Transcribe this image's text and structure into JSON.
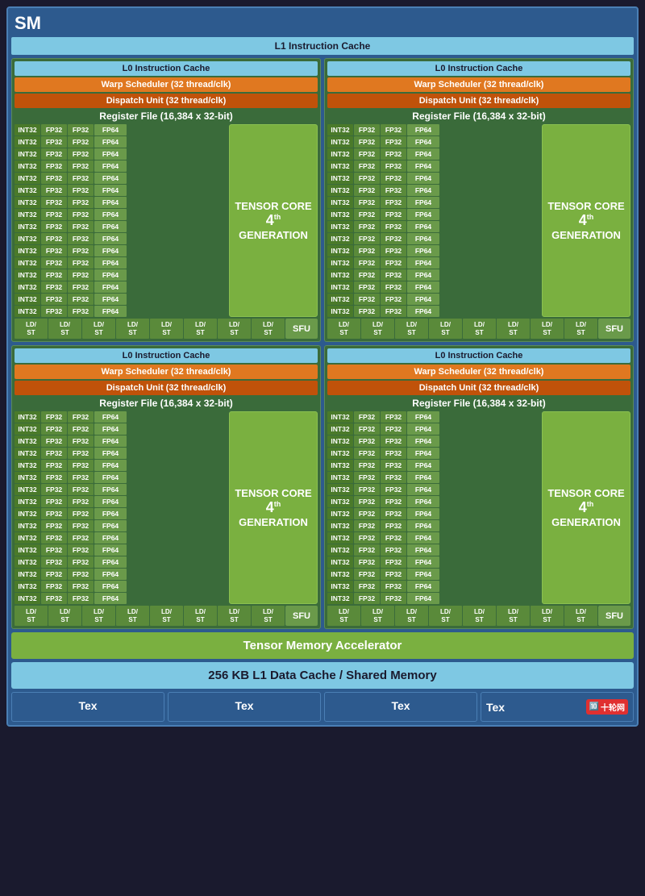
{
  "sm": {
    "title": "SM",
    "l1_instruction_cache": "L1 Instruction Cache",
    "tensor_memory_accelerator": "Tensor Memory Accelerator",
    "l1_data_cache": "256 KB L1 Data Cache / Shared Memory",
    "tex_units": [
      "Tex",
      "Tex",
      "Tex",
      "Tex"
    ],
    "logo": "十轮网"
  },
  "sub_partition": {
    "l0_cache": "L0 Instruction Cache",
    "warp_scheduler": "Warp Scheduler (32 thread/clk)",
    "dispatch_unit": "Dispatch Unit (32 thread/clk)",
    "register_file": "Register File (16,384 x 32-bit)",
    "tensor_core_line1": "TENSOR CORE",
    "tensor_core_line2": "4",
    "tensor_core_line3": "GENERATION",
    "sfu": "SFU",
    "cu_rows": [
      [
        "INT32",
        "FP32",
        "FP32",
        "FP64"
      ],
      [
        "INT32",
        "FP32",
        "FP32",
        "FP64"
      ],
      [
        "INT32",
        "FP32",
        "FP32",
        "FP64"
      ],
      [
        "INT32",
        "FP32",
        "FP32",
        "FP64"
      ],
      [
        "INT32",
        "FP32",
        "FP32",
        "FP64"
      ],
      [
        "INT32",
        "FP32",
        "FP32",
        "FP64"
      ],
      [
        "INT32",
        "FP32",
        "FP32",
        "FP64"
      ],
      [
        "INT32",
        "FP32",
        "FP32",
        "FP64"
      ],
      [
        "INT32",
        "FP32",
        "FP32",
        "FP64"
      ],
      [
        "INT32",
        "FP32",
        "FP32",
        "FP64"
      ],
      [
        "INT32",
        "FP32",
        "FP32",
        "FP64"
      ],
      [
        "INT32",
        "FP32",
        "FP32",
        "FP64"
      ],
      [
        "INT32",
        "FP32",
        "FP32",
        "FP64"
      ],
      [
        "INT32",
        "FP32",
        "FP32",
        "FP64"
      ],
      [
        "INT32",
        "FP32",
        "FP32",
        "FP64"
      ],
      [
        "INT32",
        "FP32",
        "FP32",
        "FP64"
      ]
    ],
    "ld_st_count": 8
  }
}
